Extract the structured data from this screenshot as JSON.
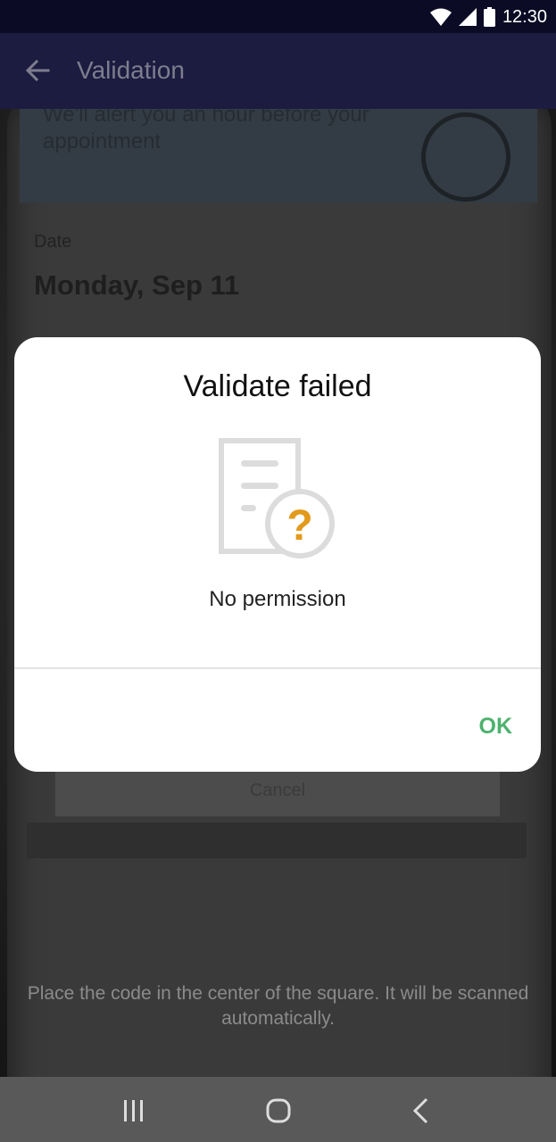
{
  "status_bar": {
    "time": "12:30"
  },
  "app_bar": {
    "title": "Validation"
  },
  "background": {
    "appointment_text": "We'll alert you an hour before your appointment",
    "date_label": "Date",
    "date_value": "Monday, Sep 11",
    "cancel_label": "Cancel",
    "hint": "Place the code in the center of the square. It will be scanned automatically."
  },
  "dialog": {
    "title": "Validate failed",
    "message": "No permission",
    "ok_label": "OK",
    "icon": "document-question-icon",
    "accent_color": "#e29a1c",
    "ok_color": "#4db26d"
  },
  "nav_bar": {
    "recents": "recents-icon",
    "home": "home-icon",
    "back": "back-icon"
  }
}
